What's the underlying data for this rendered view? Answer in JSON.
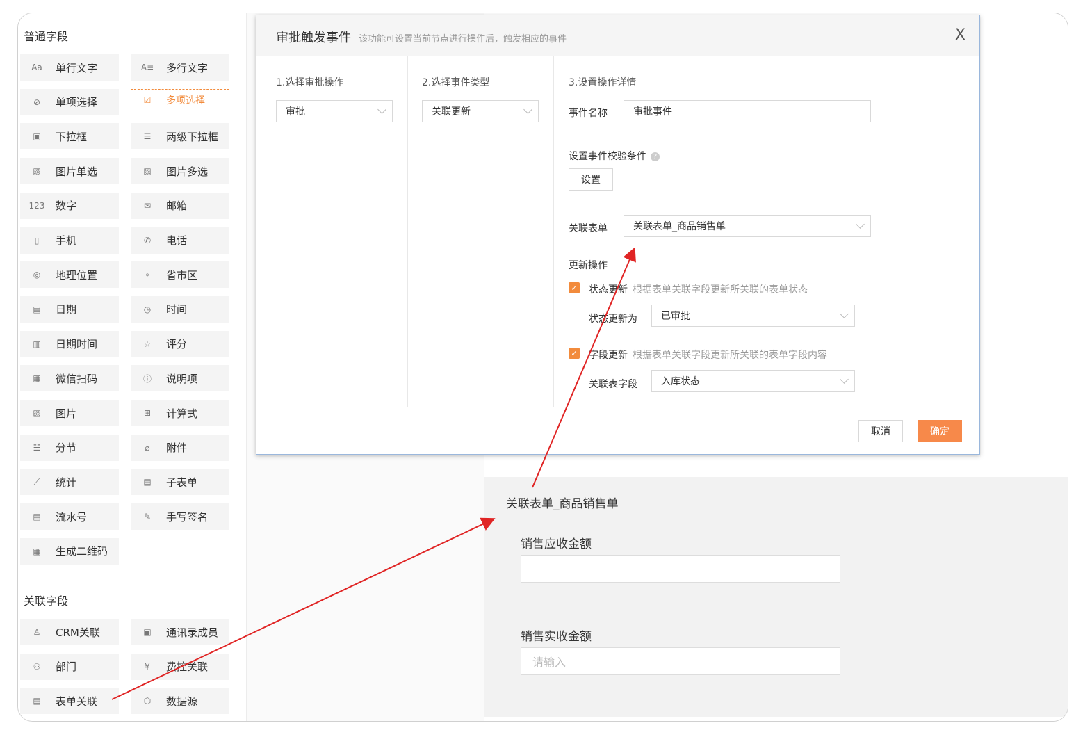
{
  "palette": {
    "basic_title": "普通字段",
    "basic_items": [
      {
        "label": "单行文字",
        "icon": "text-aa-icon"
      },
      {
        "label": "多行文字",
        "icon": "multiline-text-icon"
      },
      {
        "label": "单项选择",
        "icon": "radio-check-icon"
      },
      {
        "label": "多项选择",
        "icon": "checkbox-icon",
        "selected": true
      },
      {
        "label": "下拉框",
        "icon": "dropdown-box-icon"
      },
      {
        "label": "两级下拉框",
        "icon": "two-level-dropdown-icon"
      },
      {
        "label": "图片单选",
        "icon": "image-single-icon"
      },
      {
        "label": "图片多选",
        "icon": "image-multi-icon"
      },
      {
        "label": "数字",
        "icon": "number-123-icon"
      },
      {
        "label": "邮箱",
        "icon": "mail-icon"
      },
      {
        "label": "手机",
        "icon": "mobile-icon"
      },
      {
        "label": "电话",
        "icon": "phone-icon"
      },
      {
        "label": "地理位置",
        "icon": "location-pin-icon"
      },
      {
        "label": "省市区",
        "icon": "region-pin-icon"
      },
      {
        "label": "日期",
        "icon": "calendar-icon"
      },
      {
        "label": "时间",
        "icon": "clock-icon"
      },
      {
        "label": "日期时间",
        "icon": "calendar-clock-icon"
      },
      {
        "label": "评分",
        "icon": "star-icon"
      },
      {
        "label": "微信扫码",
        "icon": "qr-scan-icon"
      },
      {
        "label": "说明项",
        "icon": "info-icon"
      },
      {
        "label": "图片",
        "icon": "image-icon"
      },
      {
        "label": "计算式",
        "icon": "formula-icon"
      },
      {
        "label": "分节",
        "icon": "section-lines-icon"
      },
      {
        "label": "附件",
        "icon": "paperclip-icon"
      },
      {
        "label": "统计",
        "icon": "line-chart-icon"
      },
      {
        "label": "子表单",
        "icon": "subform-icon"
      },
      {
        "label": "流水号",
        "icon": "serial-number-icon"
      },
      {
        "label": "手写签名",
        "icon": "pen-icon"
      },
      {
        "label": "生成二维码",
        "icon": "qr-code-icon"
      }
    ],
    "relation_title": "关联字段",
    "relation_items": [
      {
        "label": "CRM关联",
        "icon": "user-icon"
      },
      {
        "label": "通讯录成员",
        "icon": "contact-card-icon"
      },
      {
        "label": "部门",
        "icon": "org-tree-icon"
      },
      {
        "label": "费控关联",
        "icon": "yen-circle-icon"
      },
      {
        "label": "表单关联",
        "icon": "form-link-icon"
      },
      {
        "label": "数据源",
        "icon": "cube-icon"
      }
    ]
  },
  "modal": {
    "title": "审批触发事件",
    "subtitle": "该功能可设置当前节点进行操作后，触发相应的事件",
    "close": "X",
    "col1": {
      "title": "1.选择审批操作",
      "value": "审批"
    },
    "col2": {
      "title": "2.选择事件类型",
      "value": "关联更新"
    },
    "col3": {
      "title": "3.设置操作详情",
      "event_name_label": "事件名称",
      "event_name_value": "审批事件",
      "condition_label": "设置事件校验条件",
      "condition_help": "?",
      "condition_button": "设置",
      "related_form_label": "关联表单",
      "related_form_value": "关联表单_商品销售单",
      "update_op_label": "更新操作",
      "status_update_label": "状态更新",
      "status_update_hint": "根据表单关联字段更新所关联的表单状态",
      "status_update_to_label": "状态更新为",
      "status_update_to_value": "已审批",
      "field_update_label": "字段更新",
      "field_update_hint": "根据表单关联字段更新所关联的表单字段内容",
      "related_field_label": "关联表字段",
      "related_field_value": "入库状态"
    },
    "cancel": "取消",
    "confirm": "确定"
  },
  "subform": {
    "title": "关联表单_商品销售单",
    "field1_label": "销售应收金额",
    "field1_value": "",
    "field2_label": "销售实收金额",
    "field2_placeholder": "请输入"
  },
  "colors": {
    "accent": "#f28b3c",
    "arrow": "#e02424",
    "confirm": "#f7894a"
  }
}
